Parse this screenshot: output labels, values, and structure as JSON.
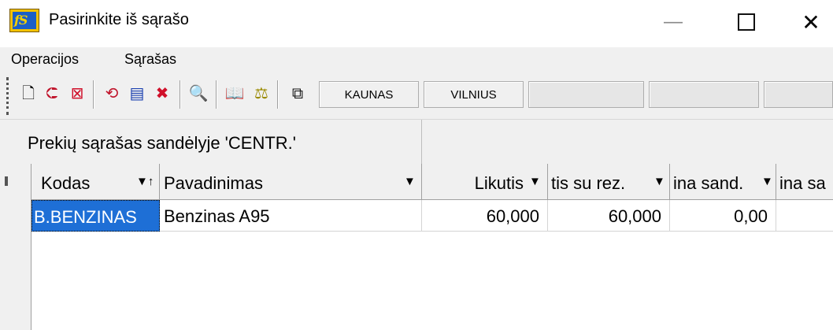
{
  "window": {
    "title": "Pasirinkite iš sąrašo",
    "icon_label": "fS",
    "minimize_glyph": "—",
    "close_glyph": "✕"
  },
  "menu": {
    "items": [
      "Operacijos",
      "Sąrašas"
    ]
  },
  "toolbar": {
    "icons": [
      {
        "name": "new-document-icon",
        "glyph": "🗋",
        "color": "#000000"
      },
      {
        "name": "import-icon",
        "glyph": "⮈",
        "color": "#c0142b"
      },
      {
        "name": "delete-icon",
        "glyph": "⊠",
        "color": "#d0102a"
      },
      {
        "name": "refresh-icon",
        "glyph": "⟲",
        "color": "#c0142b"
      },
      {
        "name": "edit-icon",
        "glyph": "▤",
        "color": "#1a3fb0"
      },
      {
        "name": "remove-filter-icon",
        "glyph": "✖",
        "color": "#d0102a"
      },
      {
        "name": "find-icon",
        "glyph": "🔍",
        "color": "#222222"
      },
      {
        "name": "catalog-icon",
        "glyph": "📖",
        "color": "#333333"
      },
      {
        "name": "weight-icon",
        "glyph": "⚖",
        "color": "#9a8a00"
      },
      {
        "name": "copy-icon",
        "glyph": "⧉",
        "color": "#111111"
      }
    ],
    "city_buttons": [
      "KAUNAS",
      "VILNIUS",
      "",
      ""
    ]
  },
  "panel": {
    "title": "Prekių sąrašas sandėlyje 'CENTR.'"
  },
  "grid": {
    "columns": [
      "Kodas",
      "Pavadinimas",
      "Likutis",
      "tis su rez.",
      "ina sand.",
      "ina sa"
    ],
    "sort_glyph": "▼↑",
    "filter_glyph": "▼",
    "rows": [
      {
        "kodas": "B.BENZINAS",
        "pavadinimas": "Benzinas A95",
        "likutis": "60,000",
        "su_rez": "60,000",
        "kaina_sand": "0,00",
        "kaina_sa": ""
      }
    ]
  }
}
